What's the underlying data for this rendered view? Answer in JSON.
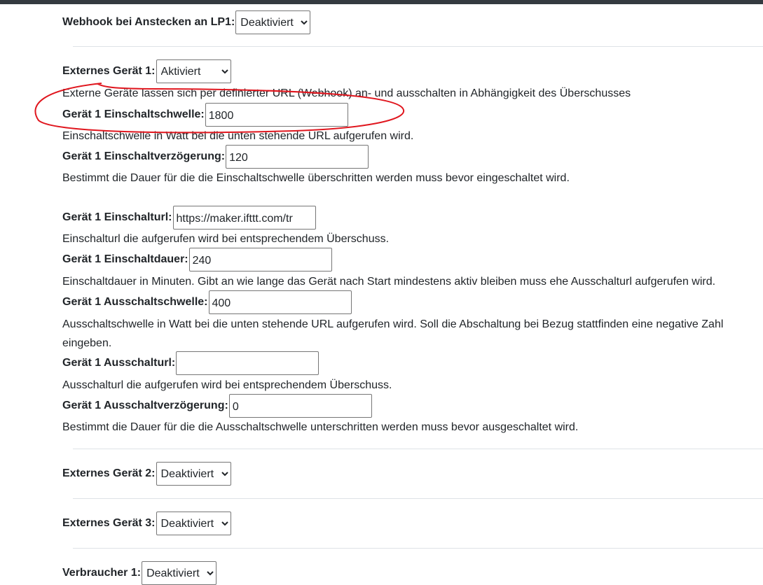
{
  "webhook": {
    "label": "Webhook bei Anstecken an LP1:",
    "value": "Deaktiviert"
  },
  "ext1": {
    "label": "Externes Gerät 1:",
    "value": "Aktiviert",
    "desc": "Externe Geräte lassen sich per definierter URL (Webhook) an- und ausschalten in Abhängigkeit des Überschusses"
  },
  "einschaltschwelle": {
    "label": "Gerät 1 Einschaltschwelle:",
    "value": "1800",
    "desc": "Einschaltschwelle in Watt bei die unten stehende URL aufgerufen wird."
  },
  "einschaltverzoegerung": {
    "label": "Gerät 1 Einschaltverzögerung:",
    "value": "120",
    "desc": "Bestimmt die Dauer für die die Einschaltschwelle überschritten werden muss bevor eingeschaltet wird."
  },
  "einschalturl": {
    "label": "Gerät 1 Einschalturl:",
    "value": "https://maker.ifttt.com/tr",
    "desc": "Einschalturl die aufgerufen wird bei entsprechendem Überschuss."
  },
  "einschaltdauer": {
    "label": "Gerät 1 Einschaltdauer:",
    "value": "240",
    "desc": "Einschaltdauer in Minuten. Gibt an wie lange das Gerät nach Start mindestens aktiv bleiben muss ehe Ausschalturl aufgerufen wird."
  },
  "ausschaltschwelle": {
    "label": "Gerät 1 Ausschaltschwelle:",
    "value": "400",
    "desc_line1": "Ausschaltschwelle in Watt bei die unten stehende URL aufgerufen wird. Soll die Abschaltung bei Bezug stattfinden eine negative Zahl",
    "desc_line2": "eingeben."
  },
  "ausschalturl": {
    "label": "Gerät 1 Ausschalturl:",
    "value": "",
    "desc": "Ausschalturl die aufgerufen wird bei entsprechendem Überschuss."
  },
  "ausschaltverzoegerung": {
    "label": "Gerät 1 Ausschaltverzögerung:",
    "value": "0",
    "desc": "Bestimmt die Dauer für die die Ausschaltschwelle unterschritten werden muss bevor ausgeschaltet wird."
  },
  "ext2": {
    "label": "Externes Gerät 2:",
    "value": "Deaktiviert"
  },
  "ext3": {
    "label": "Externes Gerät 3:",
    "value": "Deaktiviert"
  },
  "verbraucher1": {
    "label": "Verbraucher 1:",
    "value": "Deaktiviert"
  },
  "annotation_color": "#e0161e"
}
